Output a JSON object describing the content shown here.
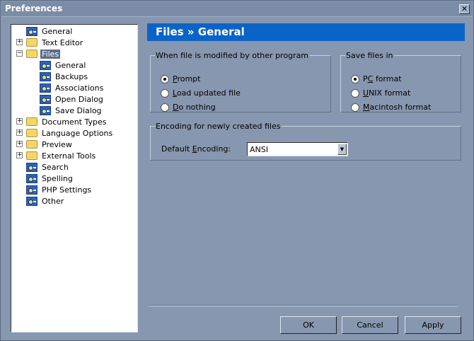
{
  "window": {
    "title": "Preferences",
    "close_icon": "close-icon"
  },
  "tree": {
    "items": [
      {
        "label": "General",
        "level": 0,
        "icon": "page",
        "expander": ""
      },
      {
        "label": "Text Editor",
        "level": 0,
        "icon": "folder",
        "expander": "+"
      },
      {
        "label": "Files",
        "level": 0,
        "icon": "folder",
        "expander": "−",
        "selected": true
      },
      {
        "label": "General",
        "level": 1,
        "icon": "page",
        "expander": ""
      },
      {
        "label": "Backups",
        "level": 1,
        "icon": "page",
        "expander": ""
      },
      {
        "label": "Associations",
        "level": 1,
        "icon": "page",
        "expander": ""
      },
      {
        "label": "Open Dialog",
        "level": 1,
        "icon": "page",
        "expander": ""
      },
      {
        "label": "Save Dialog",
        "level": 1,
        "icon": "page",
        "expander": ""
      },
      {
        "label": "Document Types",
        "level": 0,
        "icon": "folder",
        "expander": "+"
      },
      {
        "label": "Language Options",
        "level": 0,
        "icon": "folder",
        "expander": "+"
      },
      {
        "label": "Preview",
        "level": 0,
        "icon": "folder",
        "expander": "+"
      },
      {
        "label": "External Tools",
        "level": 0,
        "icon": "folder",
        "expander": "+"
      },
      {
        "label": "Search",
        "level": 0,
        "icon": "page",
        "expander": ""
      },
      {
        "label": "Spelling",
        "level": 0,
        "icon": "page",
        "expander": ""
      },
      {
        "label": "PHP Settings",
        "level": 0,
        "icon": "page",
        "expander": ""
      },
      {
        "label": "Other",
        "level": 0,
        "icon": "page",
        "expander": ""
      }
    ]
  },
  "header": {
    "title": "Files » General"
  },
  "modified": {
    "legend": "When file is modified by other program",
    "options": [
      {
        "key": "P",
        "rest": "rompt",
        "checked": true
      },
      {
        "key": "L",
        "rest": "oad updated file",
        "checked": false
      },
      {
        "key": "D",
        "rest": "o nothing",
        "checked": false
      }
    ]
  },
  "save": {
    "legend": "Save files in",
    "options": [
      {
        "pre": "P",
        "key": "C",
        "rest": " format",
        "checked": true
      },
      {
        "pre": "",
        "key": "U",
        "rest": "NIX format",
        "checked": false
      },
      {
        "pre": "",
        "key": "M",
        "rest": "acintosh format",
        "checked": false
      }
    ]
  },
  "encoding": {
    "legend": "Encoding for newly created files",
    "label_pre": "Default ",
    "label_key": "E",
    "label_rest": "ncoding:",
    "value": "ANSI"
  },
  "buttons": {
    "ok": "OK",
    "cancel": "Cancel",
    "apply": "Apply"
  }
}
